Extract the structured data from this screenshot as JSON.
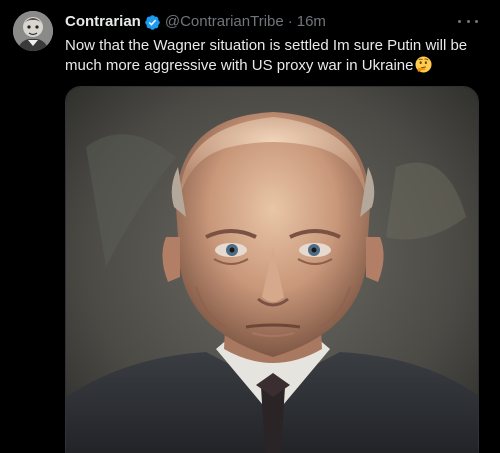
{
  "tweet": {
    "display_name": "Contrarian",
    "handle": "@ContrarianTribe",
    "separator": "·",
    "time": "16m",
    "text": "Now that the Wagner situation is settled Im sure Putin will be much more aggressive with US proxy war in Ukraine",
    "emoji": "thinking-face",
    "verified": true
  },
  "icons": {
    "verified_color": "#1d9bf0",
    "more": "more-horizontal-icon"
  },
  "colors": {
    "background": "#000000",
    "primary_text": "#e7e9ea",
    "secondary_text": "#71767b",
    "accent": "#1d9bf0"
  }
}
